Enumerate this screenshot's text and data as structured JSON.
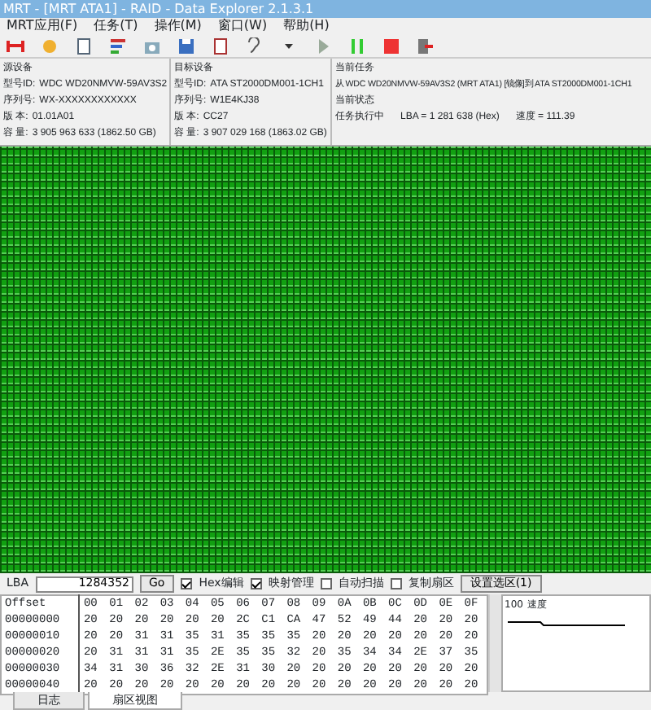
{
  "window": {
    "title": "MRT - [MRT ATA1] - RAID - Data Explorer 2.1.3.1"
  },
  "menu": [
    "MRT应用(F)",
    "任务(T)",
    "操作(M)",
    "窗口(W)",
    "帮助(H)"
  ],
  "source": {
    "heading": "源设备",
    "fields": [
      {
        "label": "型号ID:",
        "value": "WDC WD20NMVW-59AV3S2"
      },
      {
        "label": "序列号:",
        "value": "WX-XXXXXXXXXXXX"
      },
      {
        "label": "版  本:",
        "value": "01.01A01"
      },
      {
        "label": "容  量:",
        "value": "3 905 963 633 (1862.50 GB)"
      }
    ]
  },
  "target": {
    "heading": "目标设备",
    "fields": [
      {
        "label": "型号ID:",
        "value": "ATA ST2000DM001-1CH1"
      },
      {
        "label": "序列号:",
        "value": "W1E4KJ38"
      },
      {
        "label": "版  本:",
        "value": "CC27"
      },
      {
        "label": "容  量:",
        "value": "3 907 029 168 (1863.02 GB)"
      }
    ]
  },
  "task": {
    "heading": "当前任务",
    "text": "从 WDC WD20NMVW-59AV3S2 (MRT ATA1) [镜像]到 ATA ST2000DM001-1CH1"
  },
  "status": {
    "heading": "当前状态",
    "text": "任务执行中",
    "lba": "LBA = 1 281 638 (Hex)",
    "speed": "速度 = 111.39"
  },
  "controls": {
    "lba_label": "LBA",
    "lba_value": "1284352",
    "go": "Go",
    "options": [
      {
        "label": "Hex编辑",
        "checked": true
      },
      {
        "label": "映射管理",
        "checked": true
      },
      {
        "label": "自动扫描",
        "checked": false
      },
      {
        "label": "复制扇区",
        "checked": false
      }
    ],
    "select_button": "设置选区(1)"
  },
  "hex": {
    "columns": [
      "Offset",
      "00",
      "01",
      "02",
      "03",
      "04",
      "05",
      "06",
      "07",
      "08",
      "09",
      "0A",
      "0B",
      "0C",
      "0D",
      "0E",
      "0F"
    ],
    "rows": [
      [
        "00000000",
        "20",
        "20",
        "20",
        "20",
        "20",
        "20",
        "2C",
        "C1",
        "CA",
        "47",
        "52",
        "49",
        "44",
        "20",
        "20",
        "20"
      ],
      [
        "00000010",
        "20",
        "20",
        "31",
        "31",
        "35",
        "31",
        "35",
        "35",
        "35",
        "20",
        "20",
        "20",
        "20",
        "20",
        "20",
        "20"
      ],
      [
        "00000020",
        "20",
        "31",
        "31",
        "31",
        "35",
        "2E",
        "35",
        "35",
        "32",
        "20",
        "35",
        "34",
        "34",
        "2E",
        "37",
        "35"
      ],
      [
        "00000030",
        "34",
        "31",
        "30",
        "36",
        "32",
        "2E",
        "31",
        "30",
        "20",
        "20",
        "20",
        "20",
        "20",
        "20",
        "20",
        "20"
      ],
      [
        "00000040",
        "20",
        "20",
        "20",
        "20",
        "20",
        "20",
        "20",
        "20",
        "20",
        "20",
        "20",
        "20",
        "20",
        "20",
        "20",
        "20"
      ]
    ]
  },
  "speed_panel": {
    "heading": "速度",
    "axis": "100"
  },
  "tabs": [
    {
      "label": "日志",
      "selected": false
    },
    {
      "label": "扇区视图",
      "selected": true
    }
  ]
}
